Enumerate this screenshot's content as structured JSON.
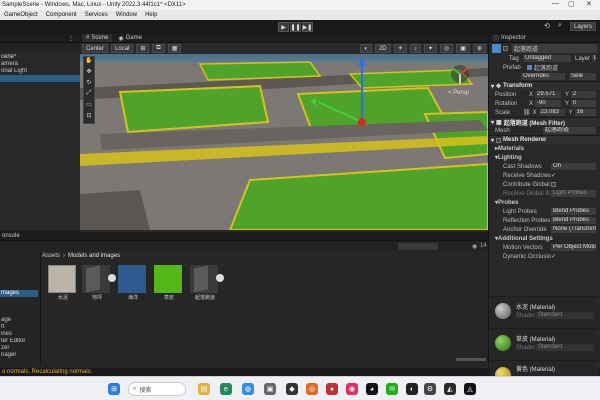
{
  "window": {
    "title": "SampleScene - Windows, Mac, Linux - Unity 2022.3.44f1c1* <DX11>"
  },
  "menu": [
    "GameObject",
    "Component",
    "Services",
    "Window",
    "Help"
  ],
  "toolbar": {
    "layers_label": "Layers",
    "play": "▶",
    "pause": "❚❚",
    "step": "▶❚"
  },
  "hierarchy": {
    "items": [
      "cene*",
      "amera",
      "onal Light",
      "",
      "",
      "",
      "",
      "",
      "",
      "",
      "",
      "",
      ""
    ]
  },
  "scene": {
    "tabs": [
      "Scene",
      "Game"
    ],
    "pivot": "Center",
    "space": "Local",
    "mode_2d": "2D",
    "persp_label": "< Persp"
  },
  "project": {
    "tab_label": "onsole",
    "breadcrumb": [
      "Assets",
      "Models and images"
    ],
    "count_label": "14",
    "folders": [
      "",
      "",
      "",
      "",
      "mages",
      "",
      "",
      "age",
      "ft",
      "ines",
      "ter Editor",
      "zer",
      "nager"
    ],
    "assets": [
      {
        "label": "水泥",
        "kind": "concrete"
      },
      {
        "label": "地坪",
        "kind": "mesh"
      },
      {
        "label": "海洋",
        "kind": "water"
      },
      {
        "label": "草皮",
        "kind": "grass"
      },
      {
        "label": "起落跑道",
        "kind": "mesh"
      }
    ]
  },
  "status": {
    "text": "o normals. Recalculating normals."
  },
  "inspector": {
    "tab_label": "Inspector",
    "object_name": "起落跑道",
    "tag_label": "Tag",
    "tag_value": "Untagged",
    "layer_label": "Layer",
    "layer_value": "D",
    "prefab_label": "Prefab",
    "prefab_value": "起落跑道",
    "overrides_label": "Overrides",
    "select_label": "Sele",
    "transform": {
      "title": "Transform",
      "position": {
        "label": "Position",
        "x": "29.571",
        "y": "2"
      },
      "rotation": {
        "label": "Rotation",
        "x": "-90",
        "y": "0"
      },
      "scale": {
        "label": "Scale",
        "x": "23.083",
        "y": "16"
      }
    },
    "mesh_filter": {
      "title": "起落跑道 (Mesh Filter)",
      "mesh_label": "Mesh",
      "mesh_value": "起落跑道"
    },
    "mesh_renderer": {
      "title": "Mesh Renderer",
      "materials": "Materials",
      "lighting": "Lighting",
      "cast_shadows": {
        "label": "Cast Shadows",
        "value": "On"
      },
      "receive_shadows": {
        "label": "Receive Shadows",
        "value": "✓"
      },
      "contribute_gi": {
        "label": "Contribute Global",
        "value": ""
      },
      "receive_gi": {
        "label": "Receive Global Ill",
        "value": "Light Probes"
      },
      "probes": "Probes",
      "light_probes": {
        "label": "Light Probes",
        "value": "Blend Probes"
      },
      "reflection_probes": {
        "label": "Reflection Probes",
        "value": "Blend Probes"
      },
      "anchor_override": {
        "label": "Anchor Override",
        "value": "None (Transform)"
      },
      "additional": "Additional Settings",
      "motion_vectors": {
        "label": "Motion Vectors",
        "value": "Per Object Motion"
      },
      "dynamic_occlusion": {
        "label": "Dynamic Occlusio",
        "value": "✓"
      }
    },
    "materials": [
      {
        "name": "水泥 (Material)",
        "shader_label": "Shader",
        "shader": "Standard",
        "color": "#8a8a8a"
      },
      {
        "name": "草皮 (Material)",
        "shader_label": "Shader",
        "shader": "Standard",
        "color": "#3d8a1f"
      },
      {
        "name": "黄色 (Material)",
        "shader_label": "Shader",
        "shader": "Standard",
        "color": "#d6b21b"
      }
    ]
  },
  "taskbar": {
    "search_label": "搜索"
  },
  "colors": {
    "accent": "#e3b341",
    "grass": "#4fa32a",
    "concrete": "#7a7a7a",
    "curb": "#d8c21a"
  }
}
